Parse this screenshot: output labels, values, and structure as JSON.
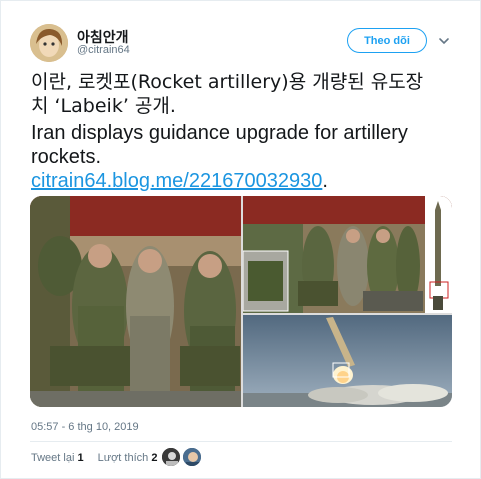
{
  "tweet": {
    "display_name": "아침안개",
    "handle": "@citrain64",
    "follow_label": "Theo dõi",
    "text_line1": "이란, 로켓포(Rocket artillery)용 개량된 유도장",
    "text_line2": "치 ‘Labeik’ 공개.",
    "text_line3": "Iran displays guidance upgrade for artillery",
    "text_line4": "rockets.",
    "link_text": "citrain64.blog.me/221670032930",
    "link_suffix": ".",
    "timestamp": "05:57 - 6 thg 10, 2019"
  },
  "stats": {
    "retweet_label": "Tweet lại",
    "retweet_count": "1",
    "like_label": "Lượt thích",
    "like_count": "2"
  },
  "icons": {
    "more": "chevron-down-icon"
  },
  "colors": {
    "accent": "#1da1f2",
    "link": "#1b95e0",
    "secondary_text": "#657786"
  }
}
